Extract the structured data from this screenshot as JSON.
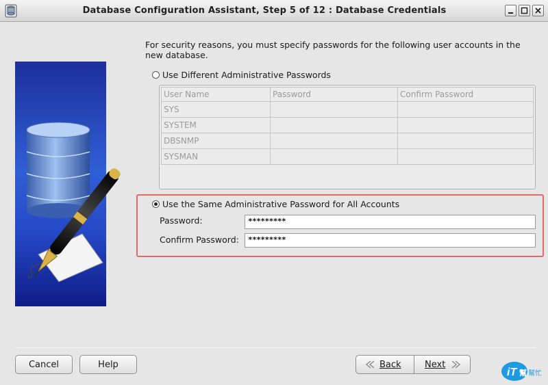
{
  "window": {
    "title": "Database Configuration Assistant, Step 5 of 12 : Database Credentials"
  },
  "intro_text": "For security reasons, you must specify passwords for the following user accounts in the new database.",
  "option_different": {
    "label": "Use Different Administrative Passwords",
    "selected": false
  },
  "user_table": {
    "columns": [
      "User Name",
      "Password",
      "Confirm Password"
    ],
    "rows": [
      [
        "SYS",
        "",
        ""
      ],
      [
        "SYSTEM",
        "",
        ""
      ],
      [
        "DBSNMP",
        "",
        ""
      ],
      [
        "SYSMAN",
        "",
        ""
      ]
    ]
  },
  "option_same": {
    "label": "Use the Same Administrative Password for All Accounts",
    "selected": true
  },
  "password_field": {
    "label": "Password:",
    "value": "*********"
  },
  "confirm_field": {
    "label": "Confirm Password:",
    "value": "*********"
  },
  "buttons": {
    "cancel": "Cancel",
    "help": "Help",
    "back": "Back",
    "next": "Next"
  },
  "watermark": {
    "brand": "iT",
    "suffix": "幫",
    "tagline": "幫忙"
  },
  "colors": {
    "highlight_border": "#e06a66",
    "art_blue": "#2f5fd6"
  }
}
